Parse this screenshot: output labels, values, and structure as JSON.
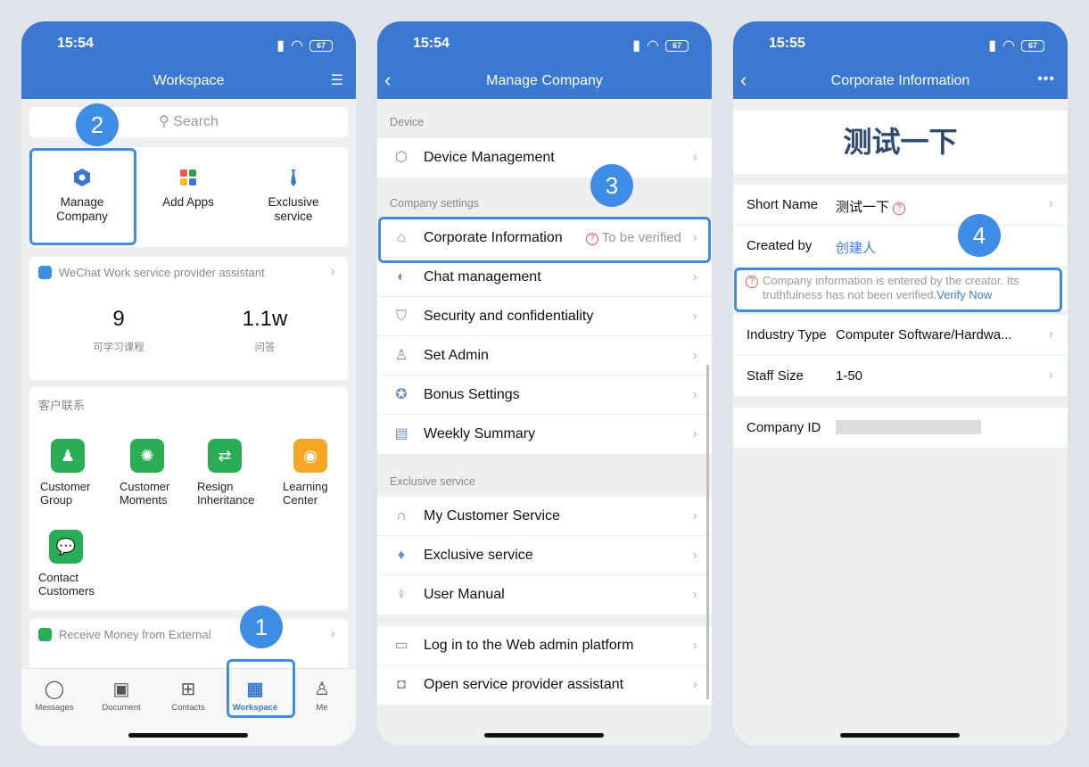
{
  "status": {
    "p1_time": "15:54",
    "p2_time": "15:54",
    "p3_time": "15:55",
    "battery": "67"
  },
  "phone1": {
    "title": "Workspace",
    "search_placeholder": "Search",
    "shortcuts": [
      "Manage\nCompany",
      "Add Apps",
      "Exclusive\nservice"
    ],
    "wechat_title": "WeChat Work service provider assistant",
    "stats": [
      {
        "num": "9",
        "label": "可学习课程"
      },
      {
        "num": "1.1w",
        "label": "问答"
      }
    ],
    "apps_title": "客户联系",
    "apps": [
      "Customer\nGroup",
      "Customer\nMoments",
      "Resign\nInheritance",
      "Learning\nCenter",
      "Contact\nCustomers"
    ],
    "money_title": "Receive Money from External",
    "tabs": [
      "Messages",
      "Document",
      "Contacts",
      "Workspace",
      "Me"
    ],
    "badges": [
      "1",
      "2"
    ]
  },
  "phone2": {
    "title": "Manage Company",
    "sections": [
      "Device",
      "Company settings",
      "Exclusive service"
    ],
    "device_items": [
      "Device Management"
    ],
    "company_items": [
      "Corporate Information",
      "Chat management",
      "Security and confidentiality",
      "Set Admin",
      "Bonus Settings",
      "Weekly Summary"
    ],
    "verify_status": "To be verified",
    "service_items": [
      "My Customer Service",
      "Exclusive service",
      "User Manual"
    ],
    "bottom_items": [
      "Log in to the Web admin platform",
      "Open service provider assistant"
    ],
    "badge": "3"
  },
  "phone3": {
    "title": "Corporate Information",
    "company_name": "测试一下",
    "short_name_label": "Short Name",
    "short_name_value": "测试一下",
    "created_by_label": "Created by",
    "created_by_value": "创建人",
    "note": "Company information is entered by the creator. Its truthfulness has not been verified.",
    "verify_link": "Verify Now",
    "industry_label": "Industry Type",
    "industry_value": "Computer Software/Hardwa...",
    "staff_label": "Staff Size",
    "staff_value": "1-50",
    "company_id_label": "Company ID",
    "badge": "4"
  },
  "colors": {
    "primary": "#3a78d2",
    "highlight": "#3d8de6",
    "alert": "#e55555"
  }
}
